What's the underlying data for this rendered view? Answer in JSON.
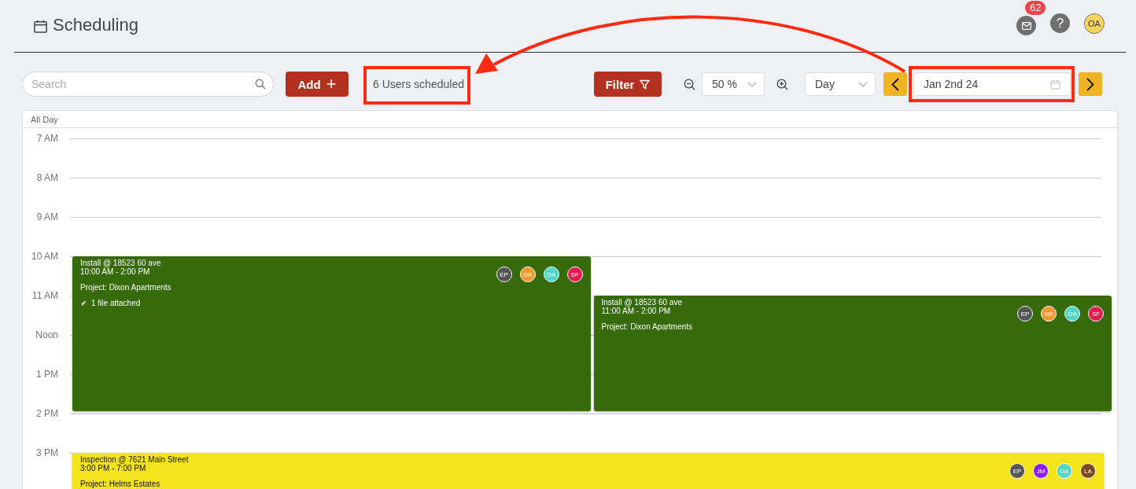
{
  "header": {
    "title": "Scheduling",
    "mail_badge": "62",
    "help": "?",
    "user_initials": "OA"
  },
  "toolbar": {
    "search": {
      "placeholder": "Search"
    },
    "add_button": "Add",
    "add_icon": "+",
    "users_scheduled": "6 Users scheduled",
    "filter_button": "Filter",
    "zoom": "50 %",
    "view": "Day",
    "date": "Jan 2nd 24"
  },
  "calendar": {
    "all_day_label": "All Day",
    "hours": [
      "7 AM",
      "8 AM",
      "9 AM",
      "10 AM",
      "11 AM",
      "Noon",
      "1 PM",
      "2 PM",
      "3 PM"
    ],
    "events": [
      {
        "kind": "install",
        "title": "Install @ 18523 60 ave",
        "time": "10:00 AM - 2:00 PM",
        "project": "Project: Dixon Apartments",
        "attachment": "1 file attached",
        "color": "#366a0b",
        "assignees": [
          {
            "initials": "EP",
            "color": "#555555"
          },
          {
            "initials": "SR",
            "color": "#f29a2e"
          },
          {
            "initials": "OA",
            "color": "#4fd8c4"
          },
          {
            "initials": "SF",
            "color": "#e8174f"
          }
        ]
      },
      {
        "kind": "install",
        "title": "Install @ 18523 60 ave",
        "time": "11:00 AM - 2:00 PM",
        "project": "Project: Dixon Apartments",
        "color": "#366a0b",
        "assignees": [
          {
            "initials": "EP",
            "color": "#555555"
          },
          {
            "initials": "SR",
            "color": "#f29a2e"
          },
          {
            "initials": "OA",
            "color": "#4fd8c4"
          },
          {
            "initials": "SF",
            "color": "#e8174f"
          }
        ]
      },
      {
        "kind": "inspection",
        "title": "Inspection @ 7621 Main Street",
        "time": "3:00 PM - 7:00 PM",
        "project": "Project: Helms Estates",
        "color": "#f5e31c",
        "assignees": [
          {
            "initials": "EP",
            "color": "#555555"
          },
          {
            "initials": "JM",
            "color": "#8a1ef0"
          },
          {
            "initials": "OA",
            "color": "#4fd8c4"
          },
          {
            "initials": "LA",
            "color": "#7b4a23"
          }
        ]
      }
    ]
  },
  "annotations": [
    {
      "kind": "highlight-box"
    },
    {
      "kind": "highlight-box"
    },
    {
      "kind": "arrow"
    }
  ]
}
